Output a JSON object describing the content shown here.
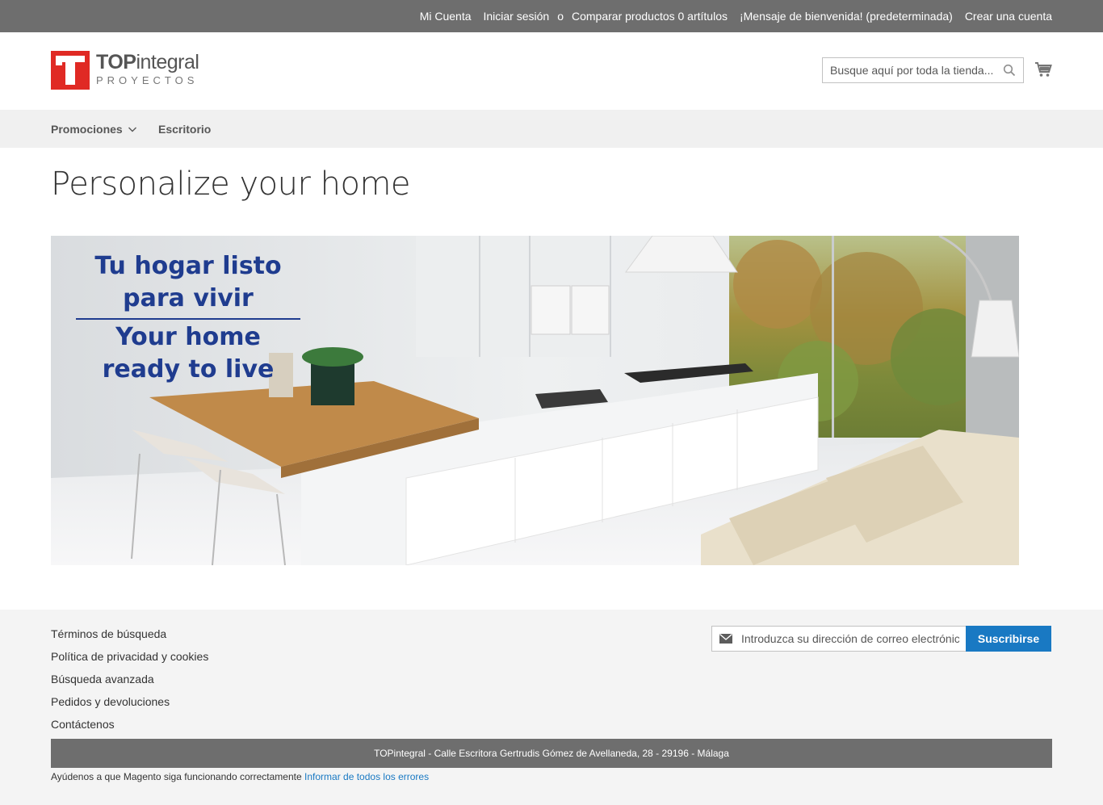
{
  "topbar": {
    "my_account": "Mi Cuenta",
    "sign_in": "Iniciar sesión",
    "or": "o",
    "compare": "Comparar productos 0 artítulos",
    "welcome": "¡Mensaje de bienvenida! (predeterminada)",
    "create_account": "Crear una cuenta"
  },
  "header": {
    "logo_top_bold": "TOP",
    "logo_top_rest": "integral",
    "logo_bottom": "PROYECTOS",
    "search_placeholder": "Busque aquí por toda la tienda...",
    "search_icon": "search-icon",
    "cart_icon": "cart-icon"
  },
  "nav": {
    "items": [
      {
        "label": "Promociones",
        "has_dropdown": true
      },
      {
        "label": "Escritorio",
        "has_dropdown": false
      }
    ]
  },
  "main": {
    "title": "Personalize your home",
    "banner": {
      "line1": "Tu hogar listo",
      "line2": "para vivir",
      "line3": "Your home",
      "line4": "ready to live"
    }
  },
  "footer": {
    "links": [
      "Términos de búsqueda",
      "Política de privacidad y cookies",
      "Búsqueda avanzada",
      "Pedidos y devoluciones",
      "Contáctenos"
    ],
    "newsletter_placeholder": "Introduzca su dirección de correo electrónico",
    "subscribe_label": "Suscribirse",
    "address": "TOPintegral - Calle Escritora Gertrudis Gómez de Avellaneda, 28 - 29196 - Málaga",
    "bugs_text": "Ayúdenos a que Magento siga funcionando correctamente",
    "bugs_link": "Informar de todos los errores"
  },
  "colors": {
    "topbar": "#6e6e6e",
    "logo_red": "#e02a24",
    "accent_blue": "#1979c3",
    "banner_text": "#1f3c8f",
    "nav_bg": "#f0f0f0"
  }
}
